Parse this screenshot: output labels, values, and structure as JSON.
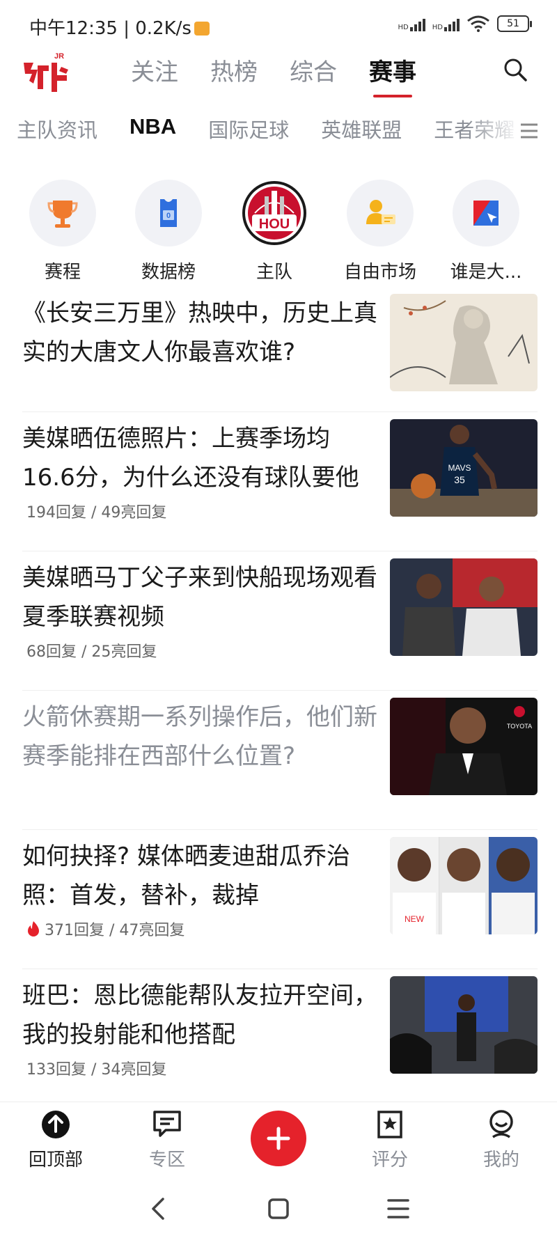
{
  "status_bar": {
    "time": "中午12:35 | 0.2K/s",
    "signal1": "HD",
    "signal2": "HD",
    "battery": "51"
  },
  "header": {
    "tabs": [
      "关注",
      "热榜",
      "综合",
      "赛事"
    ],
    "active_tab": "赛事",
    "logo_text": "虎扑",
    "logo_badge": "JR"
  },
  "sub_tabs": {
    "items": [
      "主队资讯",
      "NBA",
      "国际足球",
      "英雄联盟",
      "王者荣耀"
    ],
    "active": "NBA"
  },
  "shortcuts": [
    {
      "label": "赛程",
      "icon": "trophy-icon"
    },
    {
      "label": "数据榜",
      "icon": "jersey-icon"
    },
    {
      "label": "主队",
      "icon": "team-logo-icon",
      "badge": "HOU"
    },
    {
      "label": "自由市场",
      "icon": "free-agent-icon"
    },
    {
      "label": "谁是大...",
      "icon": "vote-icon"
    }
  ],
  "articles": [
    {
      "title": "《长安三万里》热映中，历史上真实的大唐文人你最喜欢谁?",
      "meta": "",
      "read": false,
      "hot": false
    },
    {
      "title": "美媒晒伍德照片：上赛季场均16.6分，为什么还没有球队要他",
      "meta": "194回复 / 49亮回复",
      "read": false,
      "hot": false
    },
    {
      "title": "美媒晒马丁父子来到快船现场观看夏季联赛视频",
      "meta": "68回复 / 25亮回复",
      "read": false,
      "hot": false
    },
    {
      "title": "火箭休赛期一系列操作后，他们新赛季能排在西部什么位置?",
      "meta": "",
      "read": true,
      "hot": false
    },
    {
      "title": "如何抉择? 媒体晒麦迪甜瓜乔治照：首发，替补，裁掉",
      "meta": "371回复 / 47亮回复",
      "read": false,
      "hot": true
    },
    {
      "title": "班巴：恩比德能帮队友拉开空间，我的投射能和他搭配",
      "meta": "133回复 / 34亮回复",
      "read": false,
      "hot": false
    }
  ],
  "bottom_nav": {
    "items": [
      "回顶部",
      "专区",
      "评分",
      "我的"
    ]
  },
  "colors": {
    "accent": "#e5222b",
    "muted": "#8a8e96",
    "text": "#1a1a1a"
  }
}
